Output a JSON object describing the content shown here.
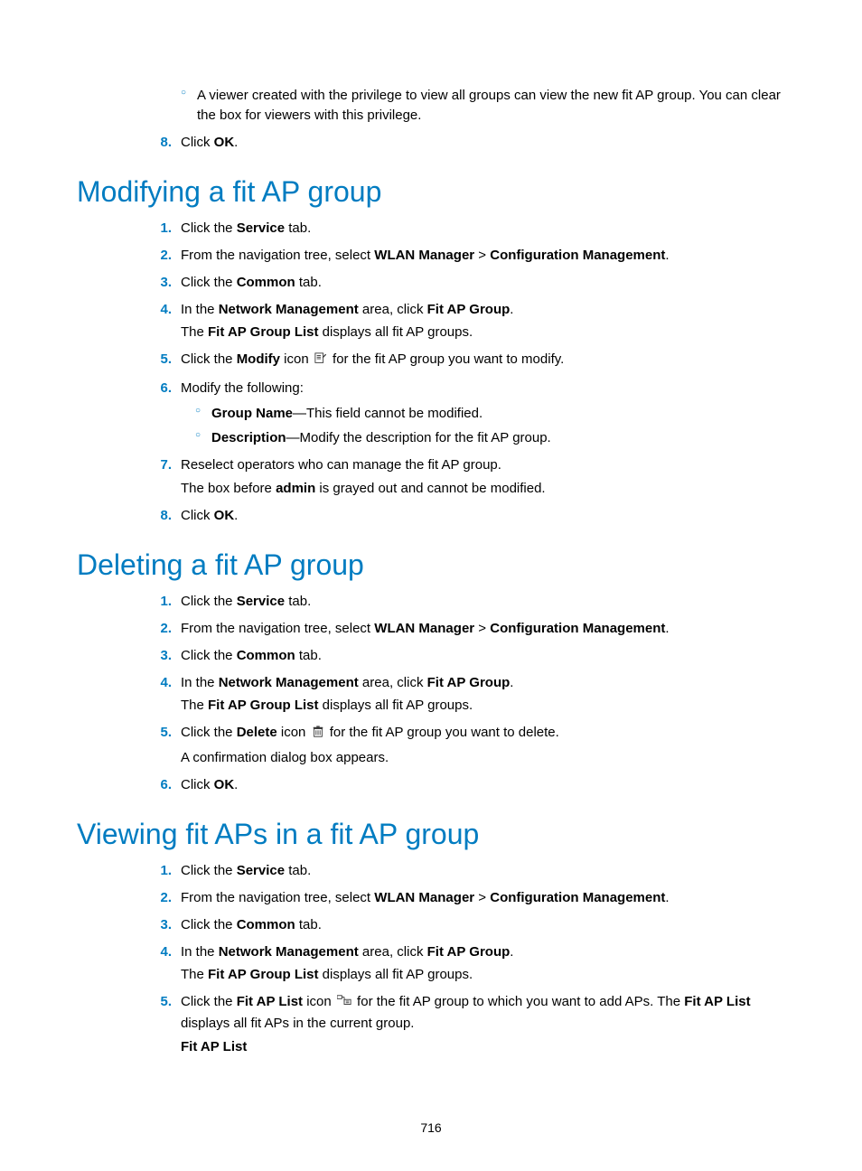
{
  "pageNumber": "716",
  "intro": {
    "bulletCircle": "A viewer created with the privilege to view all groups can view the new fit AP group. You can clear the box for viewers with this privilege.",
    "step8_pre": "Click ",
    "step8_b": "OK",
    "step8_post": "."
  },
  "sections": [
    {
      "title": "Modifying a fit AP group",
      "steps": [
        {
          "parts": [
            {
              "t": "Click the "
            },
            {
              "b": "Service"
            },
            {
              "t": " tab."
            }
          ]
        },
        {
          "parts": [
            {
              "t": "From the navigation tree, select "
            },
            {
              "b": "WLAN Manager"
            },
            {
              "t": " > "
            },
            {
              "b": "Configuration Management"
            },
            {
              "t": "."
            }
          ]
        },
        {
          "parts": [
            {
              "t": "Click the "
            },
            {
              "b": "Common"
            },
            {
              "t": " tab."
            }
          ]
        },
        {
          "parts": [
            {
              "t": "In the "
            },
            {
              "b": "Network Management"
            },
            {
              "t": " area, click "
            },
            {
              "b": "Fit AP Group"
            },
            {
              "t": "."
            }
          ],
          "after": [
            {
              "t": "The "
            },
            {
              "b": "Fit AP Group List"
            },
            {
              "t": " displays all fit AP groups."
            }
          ]
        },
        {
          "parts": [
            {
              "t": "Click the "
            },
            {
              "b": "Modify"
            },
            {
              "t": " icon "
            },
            {
              "icon": "modify"
            },
            {
              "t": " for the fit AP group you want to modify."
            }
          ]
        },
        {
          "parts": [
            {
              "t": "Modify the following:"
            }
          ],
          "subs": [
            [
              {
                "b": "Group Name"
              },
              {
                "t": "—This field cannot be modified."
              }
            ],
            [
              {
                "b": "Description"
              },
              {
                "t": "—Modify the description for the fit AP group."
              }
            ]
          ]
        },
        {
          "parts": [
            {
              "t": "Reselect operators who can manage the fit AP group."
            }
          ],
          "after": [
            {
              "t": "The box before "
            },
            {
              "b": "admin"
            },
            {
              "t": " is grayed out and cannot be modified."
            }
          ]
        },
        {
          "parts": [
            {
              "t": "Click "
            },
            {
              "b": "OK"
            },
            {
              "t": "."
            }
          ]
        }
      ]
    },
    {
      "title": "Deleting a fit AP group",
      "steps": [
        {
          "parts": [
            {
              "t": "Click the "
            },
            {
              "b": "Service"
            },
            {
              "t": " tab."
            }
          ]
        },
        {
          "parts": [
            {
              "t": "From the navigation tree, select "
            },
            {
              "b": "WLAN Manager"
            },
            {
              "t": " > "
            },
            {
              "b": "Configuration Management"
            },
            {
              "t": "."
            }
          ]
        },
        {
          "parts": [
            {
              "t": "Click the "
            },
            {
              "b": "Common"
            },
            {
              "t": " tab."
            }
          ]
        },
        {
          "parts": [
            {
              "t": "In the "
            },
            {
              "b": "Network Management"
            },
            {
              "t": " area, click "
            },
            {
              "b": "Fit AP Group"
            },
            {
              "t": "."
            }
          ],
          "after": [
            {
              "t": "The "
            },
            {
              "b": "Fit AP Group List"
            },
            {
              "t": " displays all fit AP groups."
            }
          ]
        },
        {
          "parts": [
            {
              "t": "Click the "
            },
            {
              "b": "Delete"
            },
            {
              "t": " icon "
            },
            {
              "icon": "delete"
            },
            {
              "t": " for the fit AP group you want to delete."
            }
          ],
          "after": [
            {
              "t": "A confirmation dialog box appears."
            }
          ]
        },
        {
          "parts": [
            {
              "t": "Click "
            },
            {
              "b": "OK"
            },
            {
              "t": "."
            }
          ]
        }
      ]
    },
    {
      "title": "Viewing fit APs in a fit AP group",
      "steps": [
        {
          "parts": [
            {
              "t": "Click the "
            },
            {
              "b": "Service"
            },
            {
              "t": " tab."
            }
          ]
        },
        {
          "parts": [
            {
              "t": "From the navigation tree, select "
            },
            {
              "b": "WLAN Manager"
            },
            {
              "t": " > "
            },
            {
              "b": "Configuration Management"
            },
            {
              "t": "."
            }
          ]
        },
        {
          "parts": [
            {
              "t": "Click the "
            },
            {
              "b": "Common"
            },
            {
              "t": " tab."
            }
          ]
        },
        {
          "parts": [
            {
              "t": "In the "
            },
            {
              "b": "Network Management"
            },
            {
              "t": " area, click "
            },
            {
              "b": "Fit AP Group"
            },
            {
              "t": "."
            }
          ],
          "after": [
            {
              "t": "The "
            },
            {
              "b": "Fit AP Group List"
            },
            {
              "t": " displays all fit AP groups."
            }
          ]
        },
        {
          "parts": [
            {
              "t": "Click the "
            },
            {
              "b": "Fit AP List"
            },
            {
              "t": " icon "
            },
            {
              "icon": "list"
            },
            {
              "t": " for the fit AP group to which you want to add APs. The "
            },
            {
              "b": "Fit AP List"
            },
            {
              "t": " displays all fit APs in the current group."
            }
          ],
          "after": [
            {
              "b": "Fit AP List"
            }
          ]
        }
      ]
    }
  ],
  "icons": {
    "modify": "modify-icon",
    "delete": "delete-icon",
    "list": "list-icon"
  }
}
